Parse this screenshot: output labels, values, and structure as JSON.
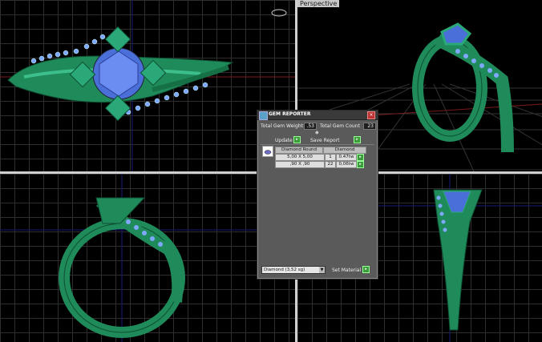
{
  "viewports": {
    "top_label": "",
    "perspective_label": "Perspective",
    "front_label": "",
    "right_label": ""
  },
  "dialog": {
    "title": "GEM REPORTER",
    "total_weight_label": "Total Gem Weight",
    "total_weight_value": ".53",
    "total_count_label": "Total Gem Count",
    "total_count_value": "23",
    "update_label": "Update",
    "save_report_label": "Save Report",
    "table": {
      "headers": [
        "Diamond Round",
        "Diamond"
      ],
      "rows": [
        {
          "size": "5,00 X 5,00",
          "count": "1",
          "weight": "0.47tw"
        },
        {
          "size": ",90 X ,90",
          "count": "22",
          "weight": "0,06tw"
        }
      ]
    },
    "material_select": "Diamond   (3,52 sg)",
    "set_material_label": "Set Material"
  },
  "colors": {
    "ring": "#1f8a5a",
    "gem": "#4a6fd8",
    "prong": "#2aa878",
    "grid": "#2e2e2e",
    "viewport_border": "#cfcfcf",
    "dialog_bg": "#5a5a5a"
  }
}
